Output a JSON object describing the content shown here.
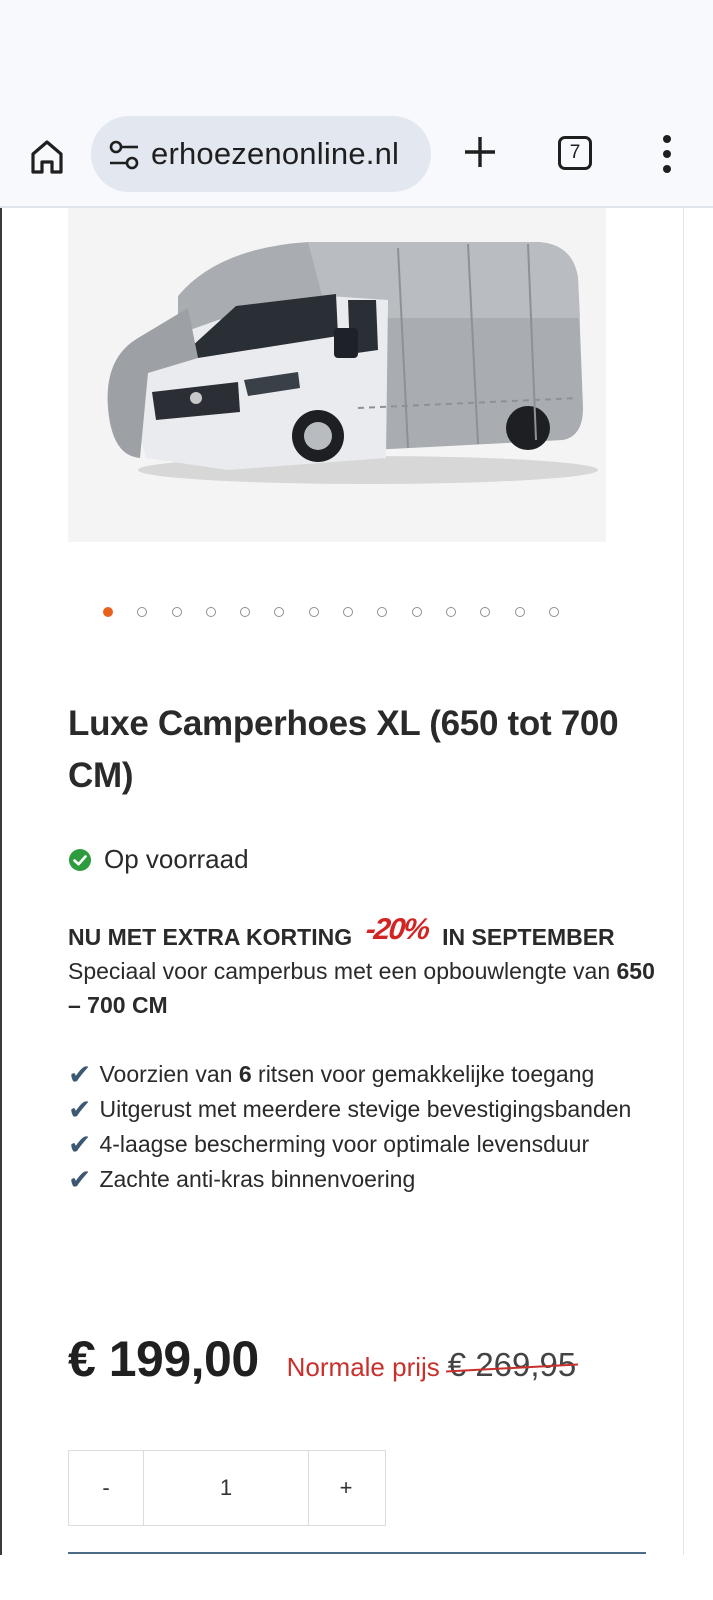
{
  "browser": {
    "url": "erhoezenonline.nl",
    "tab_count": "7",
    "icons": {
      "home": "home-icon",
      "site_settings": "tune-icon",
      "new_tab": "plus-icon",
      "tabs": "tab-switcher-icon",
      "menu": "more-vert-icon"
    }
  },
  "gallery": {
    "image": "camper-with-grey-cover",
    "dot_count": 14,
    "active_index": 0,
    "active_color": "#e8621c"
  },
  "product": {
    "title": "Luxe Camperhoes XL (650 tot 700 CM)",
    "stock": "Op voorraad",
    "stock_color": "#2e9b3e"
  },
  "promo": {
    "head_left": "NU MET EXTRA KORTING",
    "badge": "-20%",
    "head_right": "IN SEPTEMBER",
    "line1": "Speciaal voor camperbus met een opbouwlengte van",
    "line1_bold": "650 – 700 CM",
    "accent": "#d32424"
  },
  "features": [
    {
      "pre": "Voorzien van ",
      "bold": "6",
      "post": " ritsen voor gemakkelijke toegang"
    },
    {
      "pre": "Uitgerust met meerdere stevige bevestigingsbanden",
      "bold": "",
      "post": ""
    },
    {
      "pre": "4-laagse bescherming voor optimale levensduur",
      "bold": "",
      "post": ""
    },
    {
      "pre": "Zachte anti-kras binnenvoering",
      "bold": "",
      "post": ""
    }
  ],
  "check_symbol": "✔",
  "pricing": {
    "price": "€ 199,00",
    "normal_label": "Normale prijs",
    "normal_price": "€ 269,95"
  },
  "quantity": {
    "minus": "-",
    "value": "1",
    "plus": "+"
  }
}
